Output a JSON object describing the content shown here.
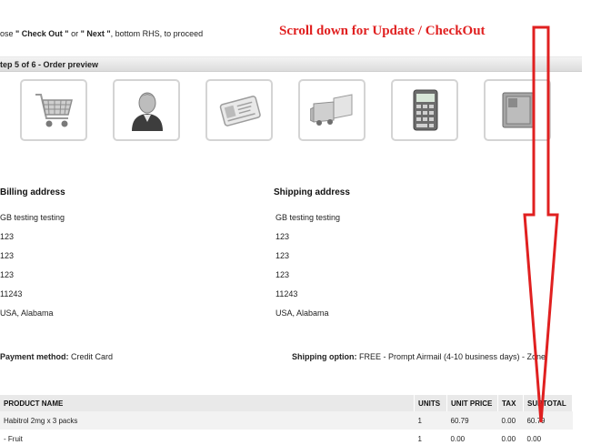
{
  "instructions": {
    "prefix": "ose ",
    "checkout": "\" Check Out \"",
    "or": " or ",
    "next": "\" Next \"",
    "suffix": ", bottom RHS, to proceed"
  },
  "scroll_hint": "Scroll down for Update / CheckOut",
  "step_bar": {
    "label": "tep 5 of 6 - Order preview"
  },
  "step_icons": [
    {
      "name": "cart-icon"
    },
    {
      "name": "user-icon"
    },
    {
      "name": "id-card-icon"
    },
    {
      "name": "truck-icon"
    },
    {
      "name": "calculator-icon"
    },
    {
      "name": "safe-icon"
    }
  ],
  "billing": {
    "title": "Billing address",
    "lines": [
      "GB testing testing",
      "123",
      "123",
      "123",
      "11243",
      "USA, Alabama"
    ]
  },
  "shipping": {
    "title": "Shipping address",
    "lines": [
      "GB testing testing",
      "123",
      "123",
      "123",
      "11243",
      "USA, Alabama"
    ]
  },
  "payment": {
    "label": "Payment method:",
    "value": "Credit Card"
  },
  "shipping_option": {
    "label": "Shipping option:",
    "value": "FREE - Prompt Airmail (4-10 business days) - Zone"
  },
  "table": {
    "headers": [
      "PRODUCT NAME",
      "UNITS",
      "UNIT PRICE",
      "TAX",
      "SUBTOTAL"
    ],
    "rows": [
      [
        "Habitrol 2mg x 3 packs",
        "1",
        "60.79",
        "0.00",
        "60.79"
      ],
      [
        "- Fruit",
        "1",
        "0.00",
        "0.00",
        "0.00"
      ]
    ]
  },
  "colors": {
    "annotation_red": "#e02020",
    "bar_gray": "#dcdcdc"
  }
}
